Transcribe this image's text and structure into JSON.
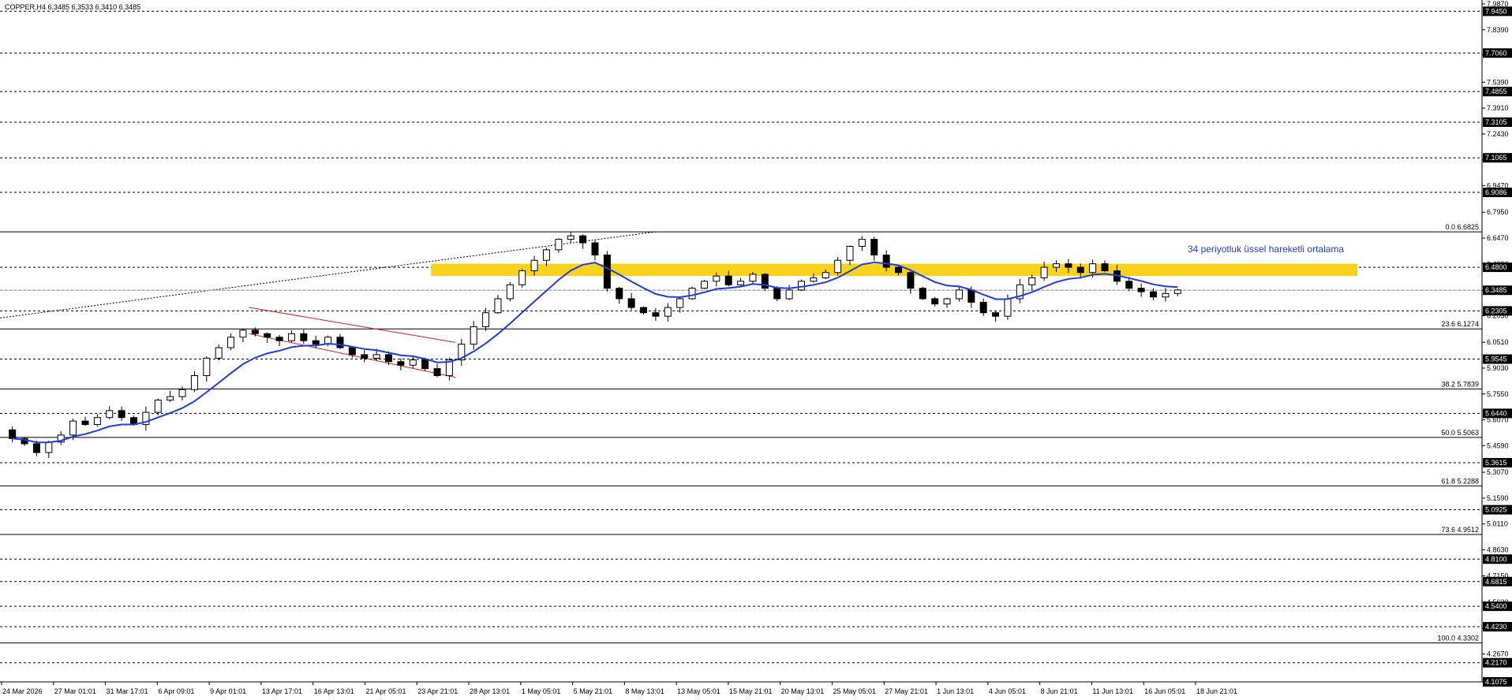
{
  "chart_header": {
    "symbol_text": "COPPER,H4  6.3485 6.3533 6.3410 6.3485"
  },
  "annotation": {
    "ema_label": "34 periyotluk üssel hareketli ortalama"
  },
  "colors": {
    "background": "#ffffff",
    "candle": "#000000",
    "ema": "#1f3de0",
    "zone": "#f9d21c",
    "channel": "#d81e1e",
    "level_box": "#000000",
    "level_text": "#ffffff"
  },
  "chart_data": {
    "type": "candlestick",
    "symbol": "COPPER",
    "timeframe": "H4",
    "ohlc_header": {
      "open": 6.3485,
      "high": 6.3533,
      "low": 6.341,
      "close": 6.3485
    },
    "ylim": [
      4.1075,
      7.987
    ],
    "y_ticks": [
      "7.9870",
      "7.8390",
      "7.6955",
      "7.5390",
      "7.3910",
      "7.2430",
      "7.0950",
      "6.9470",
      "6.7950",
      "6.6470",
      "6.4990",
      "6.3485",
      "6.2030",
      "6.0510",
      "5.9030",
      "5.7550",
      "5.6070",
      "5.4590",
      "5.3070",
      "5.1590",
      "5.0110",
      "4.8630",
      "4.7150",
      "4.5630",
      "4.4150",
      "4.2670",
      "4.1075"
    ],
    "x_ticks": [
      "24 Mar 2026",
      "27 Mar 01:01",
      "31 Mar 17:01",
      "6 Apr 09:01",
      "9 Apr 01:01",
      "13 Apr 17:01",
      "16 Apr 13:01",
      "21 Apr 05:01",
      "23 Apr 21:01",
      "28 Apr 13:01",
      "1 May 05:01",
      "5 May 21:01",
      "8 May 13:01",
      "13 May 05:01",
      "15 May 21:01",
      "20 May 13:01",
      "25 May 05:01",
      "27 May 21:01",
      "1 Jun 13:01",
      "4 Jun 05:01",
      "8 Jun 21:01",
      "11 Jun 13:01",
      "16 Jun 05:01",
      "18 Jun 21:01"
    ],
    "horizontal_levels": [
      "7.9450",
      "7.7060",
      "7.4855",
      "7.3105",
      "7.1065",
      "6.9086",
      "6.4800",
      "6.3485",
      "6.2305",
      "5.9545",
      "5.6440",
      "5.3615",
      "5.0925",
      "4.8100",
      "4.6815",
      "4.5400",
      "4.4230",
      "4.2170",
      "4.1075"
    ],
    "fibonacci": [
      {
        "label": "0.0 6.6825",
        "value": 6.6825
      },
      {
        "label": "23.6 6.1274",
        "value": 6.1274
      },
      {
        "label": "38.2 5.7839",
        "value": 5.7839
      },
      {
        "label": "50.0 5.5063",
        "value": 5.5063
      },
      {
        "label": "61.8 5.2288",
        "value": 5.2288
      },
      {
        "label": "73.6 4.9512",
        "value": 4.9512
      },
      {
        "label": "100.0 4.3302",
        "value": 4.3302
      }
    ],
    "price_path": [
      5.55,
      5.5,
      5.47,
      5.42,
      5.48,
      5.52,
      5.6,
      5.58,
      5.62,
      5.66,
      5.62,
      5.58,
      5.65,
      5.72,
      5.74,
      5.78,
      5.86,
      5.96,
      6.02,
      6.08,
      6.12,
      6.1,
      6.08,
      6.06,
      6.1,
      6.06,
      6.04,
      6.08,
      6.02,
      5.98,
      5.96,
      5.98,
      5.94,
      5.92,
      5.95,
      5.9,
      5.86,
      5.95,
      6.04,
      6.14,
      6.22,
      6.3,
      6.38,
      6.46,
      6.52,
      6.58,
      6.64,
      6.66,
      6.62,
      6.55,
      6.36,
      6.3,
      6.25,
      6.22,
      6.2,
      6.25,
      6.3,
      6.36,
      6.4,
      6.43,
      6.38,
      6.4,
      6.44,
      6.36,
      6.3,
      6.35,
      6.4,
      6.42,
      6.45,
      6.52,
      6.6,
      6.64,
      6.55,
      6.48,
      6.45,
      6.36,
      6.3,
      6.27,
      6.3,
      6.35,
      6.28,
      6.22,
      6.2,
      6.3,
      6.38,
      6.42,
      6.48,
      6.5,
      6.48,
      6.45,
      6.5,
      6.46,
      6.4,
      6.36,
      6.34,
      6.31,
      6.33,
      6.35
    ],
    "ema_period": 34,
    "zone": {
      "low": 6.43,
      "high": 6.5
    },
    "channel_upper": {
      "start": 6.25,
      "end": 6.05
    },
    "channel_lower": {
      "start": 6.1,
      "end": 5.85
    }
  }
}
